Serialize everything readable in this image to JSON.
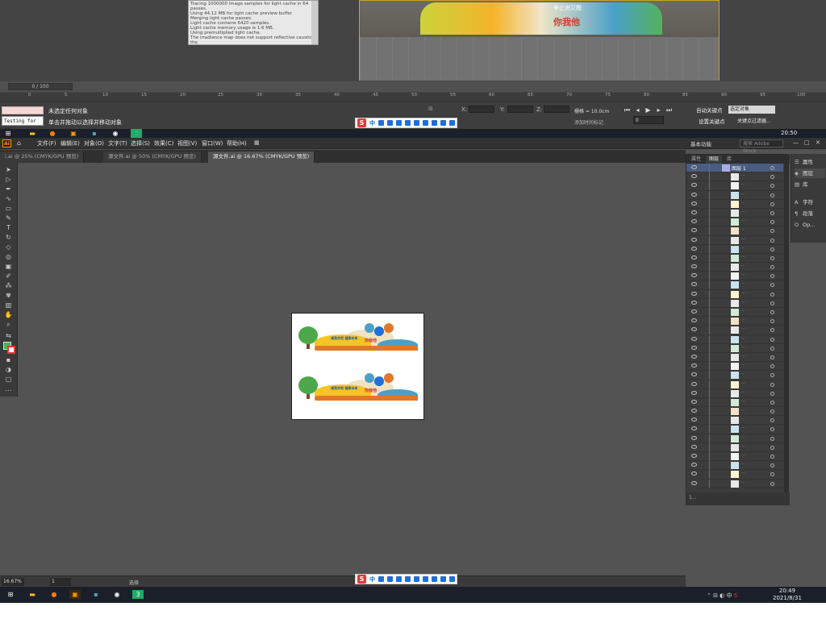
{
  "max": {
    "log_lines": [
      "Tracing 1000000 image samples for light cache in 64 passes.",
      "Using 44.12 MB for light cache preview buffer",
      "Merging light cache passes.",
      "Light cache contains 6420 samples.",
      "Light cache memory usage is 1.6 MB.",
      "Using premultiplied light cache.",
      "The irradiance map does not support reflective caustics; the"
    ],
    "mural_text_top": "争止进又酣",
    "mural_text": "你我他",
    "frame_counter": "0 / 100",
    "ruler_ticks": [
      "0",
      "5",
      "10",
      "15",
      "20",
      "25",
      "30",
      "35",
      "40",
      "45",
      "50",
      "55",
      "60",
      "65",
      "70",
      "75",
      "80",
      "85",
      "90",
      "95",
      "100"
    ],
    "testing_label": "Testing for AI",
    "status_line1": "未选定任何对象",
    "status_line2": "单击并拖动以选择并移动对象",
    "x_label": "X:",
    "y_label": "Y:",
    "z_label": "Z:",
    "grid_text": "栅格 = 10.0cm",
    "add_time_tag": "添加时间标记",
    "frame_value": "0",
    "auto_key": "自动关键点",
    "auto_key_select": "选定对象",
    "set_key": "设置关键点",
    "key_filter": "关键点过滤器..."
  },
  "ime": {
    "logo": "S",
    "chinese": "中",
    "icons": [
      "moon-icon",
      "dot-icon",
      "emoji-icon",
      "mic-icon",
      "keyboard-icon",
      "user-icon",
      "shirt-icon",
      "scissors-icon",
      "grid-icon"
    ]
  },
  "taskbar_top": {
    "clock_time": "20:50"
  },
  "ai": {
    "logo": "Ai",
    "menus": [
      "文件(F)",
      "编辑(E)",
      "对象(O)",
      "文字(T)",
      "选择(S)",
      "效果(C)",
      "视图(V)",
      "窗口(W)",
      "帮助(H)"
    ],
    "workspace": "基本功能",
    "search_placeholder": "搜索 Adobe Stock",
    "tabs": [
      "i.ai @ 25% (CMYK/GPU 预览)",
      "源文件.ai @ 50% (CMYK/GPU 预览)",
      "源文件.ai @ 16.67% (CMYK/GPU 预览)"
    ],
    "art_title": "单止进又明",
    "art_slogan": "你我他",
    "art_left_text": "请我共同 健康未来",
    "zoom": "16.67%",
    "artboard_num": "1",
    "selection_label": "选择",
    "layers_panel": {
      "tabs": [
        "属性",
        "图层",
        "库"
      ],
      "layer_name": "图层 1",
      "footer": "1..."
    },
    "dock": [
      {
        "icon": "properties-icon",
        "label": "属性"
      },
      {
        "icon": "layers-icon",
        "label": "图层"
      },
      {
        "icon": "library-icon",
        "label": "库"
      },
      {
        "icon": "character-icon",
        "label": "字符"
      },
      {
        "icon": "paragraph-icon",
        "label": "段落"
      },
      {
        "icon": "opentype-icon",
        "label": "Op..."
      }
    ]
  },
  "taskbar_bottom": {
    "time": "20:49",
    "date": "2021/8/31"
  },
  "colors": {
    "ai_bg": "#535353",
    "accent_blue": "#3d6fd6",
    "ime_red": "#e53935",
    "ai_orange": "#ff9a00"
  }
}
